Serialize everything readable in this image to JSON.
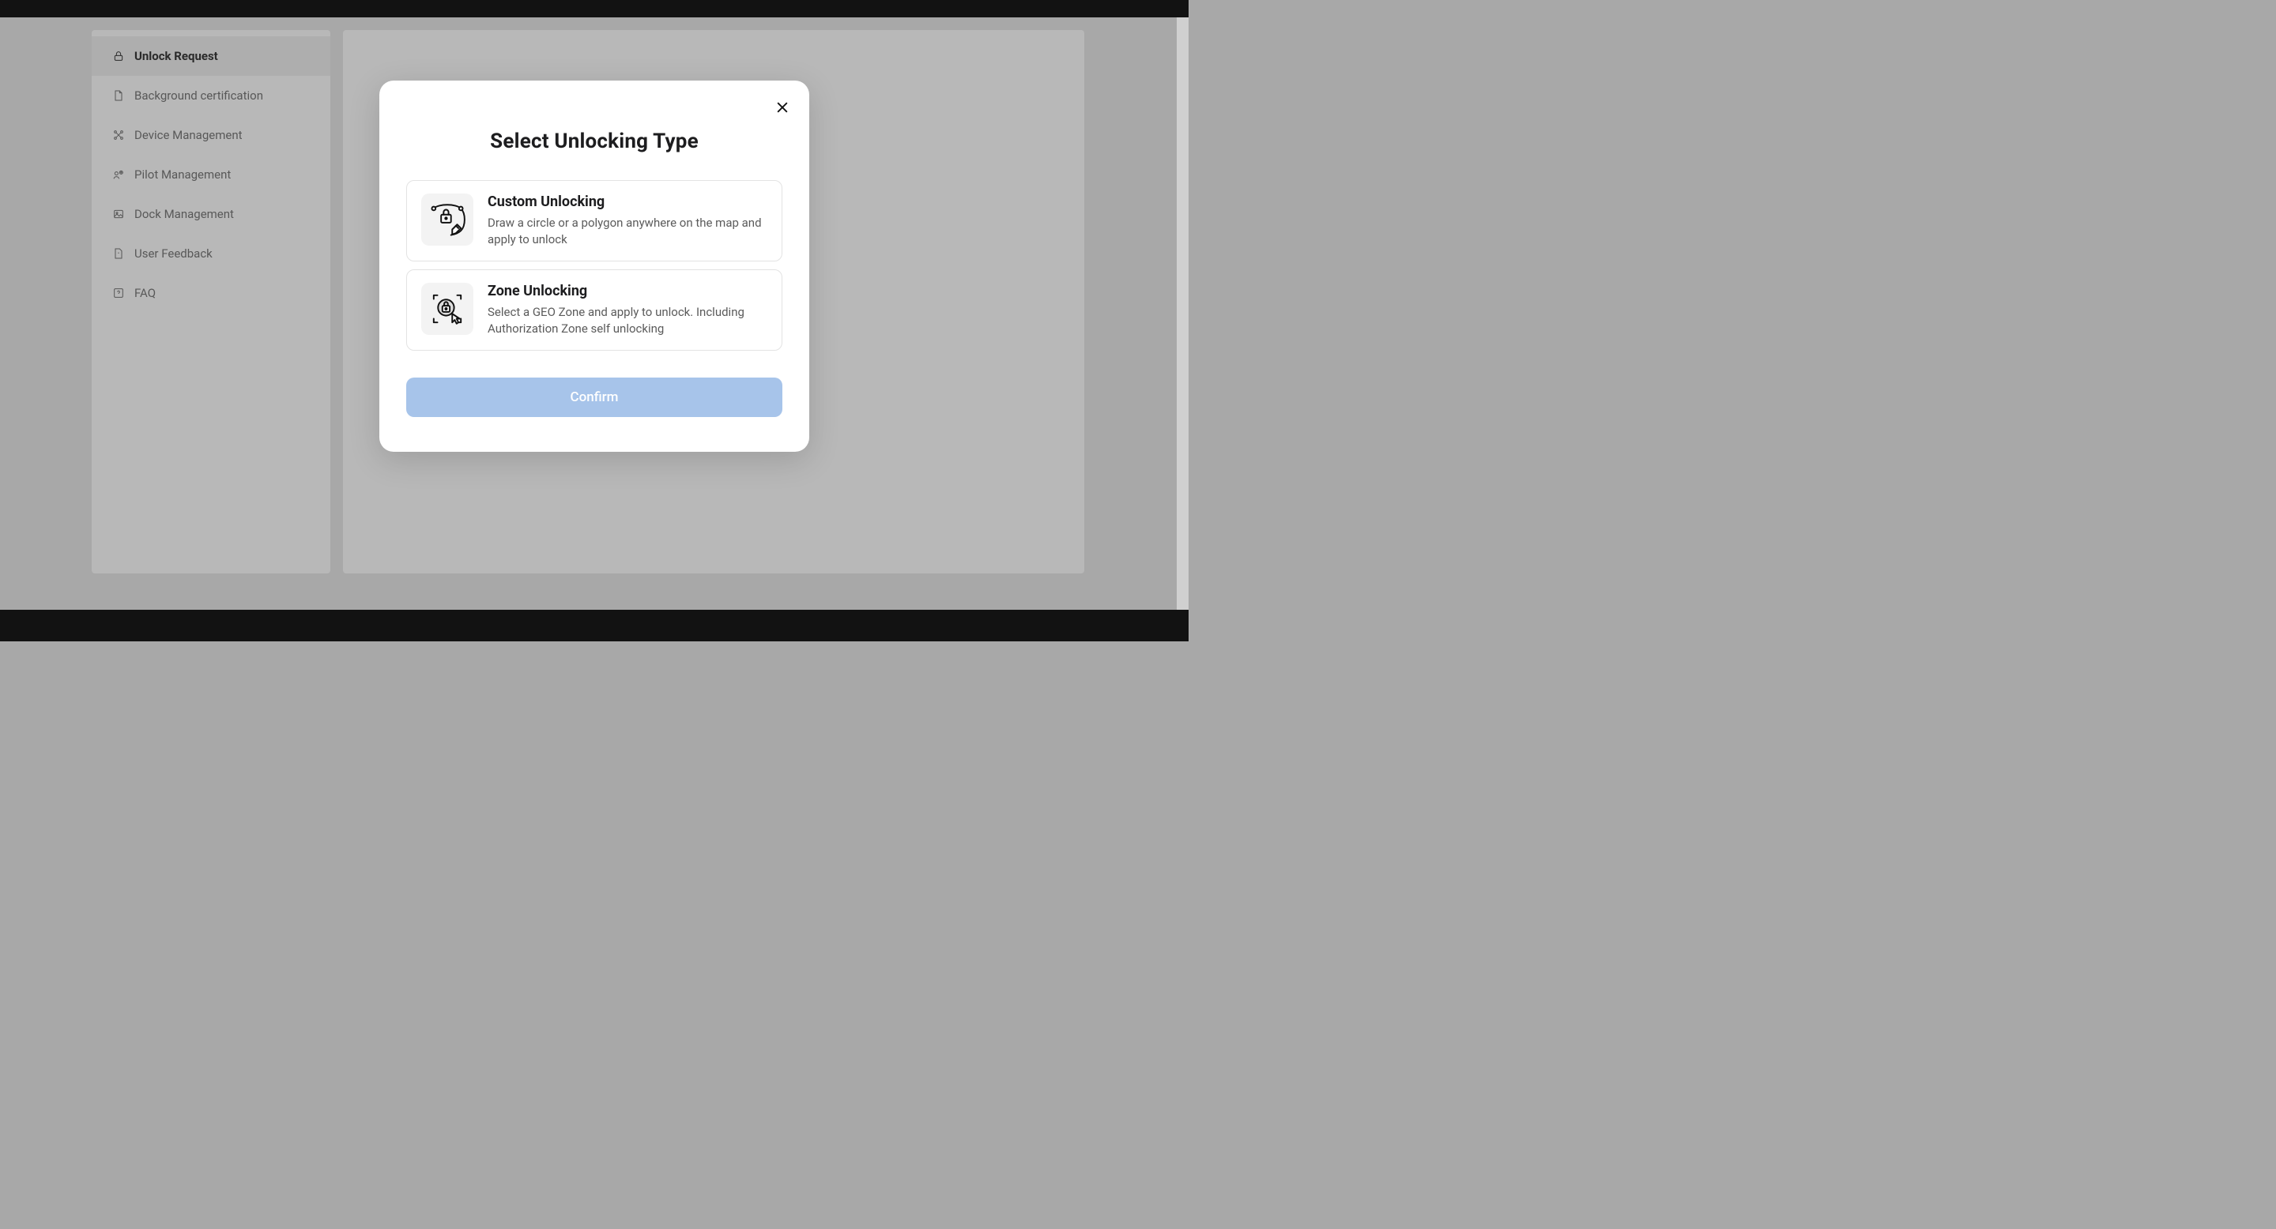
{
  "sidebar": {
    "items": [
      {
        "label": "Unlock Request",
        "icon": "lock",
        "active": true
      },
      {
        "label": "Background certification",
        "icon": "file"
      },
      {
        "label": "Device Management",
        "icon": "drone"
      },
      {
        "label": "Pilot Management",
        "icon": "pilot"
      },
      {
        "label": "Dock Management",
        "icon": "image"
      },
      {
        "label": "User Feedback",
        "icon": "feedback"
      },
      {
        "label": "FAQ",
        "icon": "help"
      }
    ]
  },
  "modal": {
    "title": "Select Unlocking Type",
    "options": [
      {
        "title": "Custom Unlocking",
        "desc": "Draw a circle or a polygon anywhere on the map and apply to unlock"
      },
      {
        "title": "Zone Unlocking",
        "desc": "Select a GEO Zone and apply to unlock. Including Authorization Zone self unlocking"
      }
    ],
    "confirm_label": "Confirm"
  }
}
